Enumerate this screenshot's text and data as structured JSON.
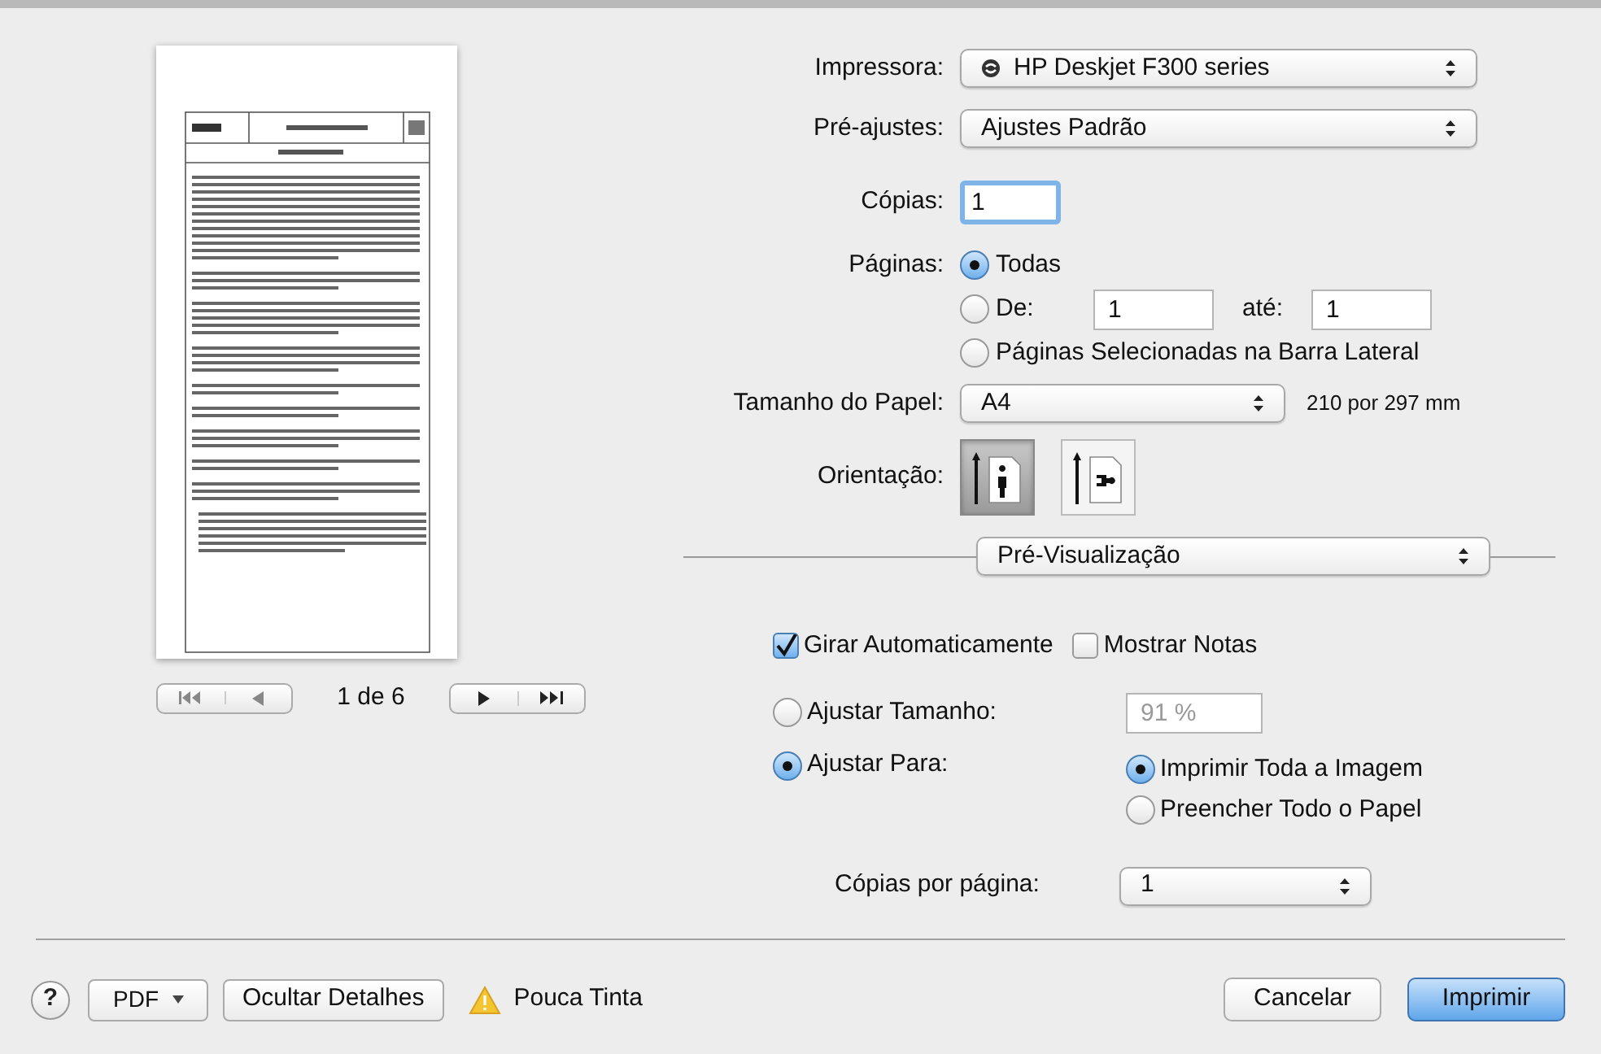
{
  "printer": {
    "label": "Impressora:",
    "value": "HP Deskjet F300 series"
  },
  "presets": {
    "label": "Pré-ajustes:",
    "value": "Ajustes Padrão"
  },
  "copies": {
    "label": "Cópias:",
    "value": "1"
  },
  "pages": {
    "label": "Páginas:",
    "options": [
      {
        "kind": "all",
        "label": "Todas",
        "selected": true
      },
      {
        "kind": "range",
        "label": "De:",
        "selected": false,
        "from": "1",
        "to_label": "até:",
        "to": "1"
      },
      {
        "kind": "sidebar",
        "label": "Páginas Selecionadas na Barra Lateral",
        "selected": false
      }
    ]
  },
  "paper_size": {
    "label": "Tamanho do Papel:",
    "value": "A4",
    "dimensions": "210 por 297 mm"
  },
  "orientation": {
    "label": "Orientação:",
    "options": [
      {
        "kind": "portrait",
        "selected": true
      },
      {
        "kind": "landscape",
        "selected": false
      }
    ]
  },
  "section_popup": {
    "value": "Pré-Visualização"
  },
  "checkboxes": [
    {
      "label": "Girar Automaticamente",
      "checked": true
    },
    {
      "label": "Mostrar Notas",
      "checked": false
    }
  ],
  "scale": {
    "options": [
      {
        "kind": "size",
        "label": "Ajustar Tamanho:",
        "selected": false,
        "value": "91 %"
      },
      {
        "kind": "fit",
        "label": "Ajustar Para:",
        "selected": true
      }
    ]
  },
  "fit_options": [
    {
      "label": "Imprimir Toda a Imagem",
      "selected": true
    },
    {
      "label": "Preencher Todo o Papel",
      "selected": false
    }
  ],
  "copies_per_page": {
    "label": "Cópias por página:",
    "value": "1"
  },
  "preview": {
    "page_indicator": "1 de 6"
  },
  "footer": {
    "help": "?",
    "pdf": "PDF",
    "details": "Ocultar Detalhes",
    "warning": "Pouca Tinta",
    "buttons": [
      {
        "label": "Cancelar",
        "kind": "cancel"
      },
      {
        "label": "Imprimir",
        "kind": "default"
      }
    ]
  }
}
